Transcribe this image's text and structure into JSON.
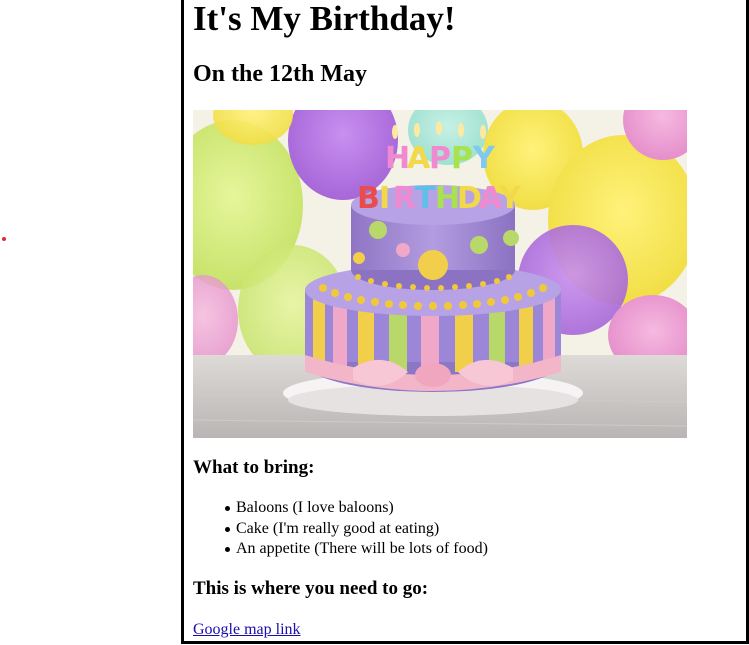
{
  "page": {
    "title": "It's My Birthday!",
    "subtitle": "On the 12th May"
  },
  "hero_image": {
    "alt": "Birthday cake with Happy Birthday candles and balloons",
    "candle_text": [
      "HAPPY",
      "BIRTHDAY"
    ],
    "colors": {
      "cake_top": "#a38bd4",
      "cake_bottom": "#9b86d8",
      "stripe_yellow": "#f2cf4a",
      "stripe_green": "#b9d86a",
      "stripe_pink": "#f0a8c8",
      "ribbon": "#f3b6c9"
    }
  },
  "what_to_bring": {
    "heading": "What to bring:",
    "items": [
      "Baloons (I love baloons)",
      "Cake (I'm really good at eating)",
      "An appetite (There will be lots of food)"
    ]
  },
  "directions": {
    "heading": "This is where you need to go:",
    "link_text": "Google map link"
  },
  "colors": {
    "link": "#1a0dab",
    "border": "#000000",
    "stray_dot": "#d93030"
  }
}
